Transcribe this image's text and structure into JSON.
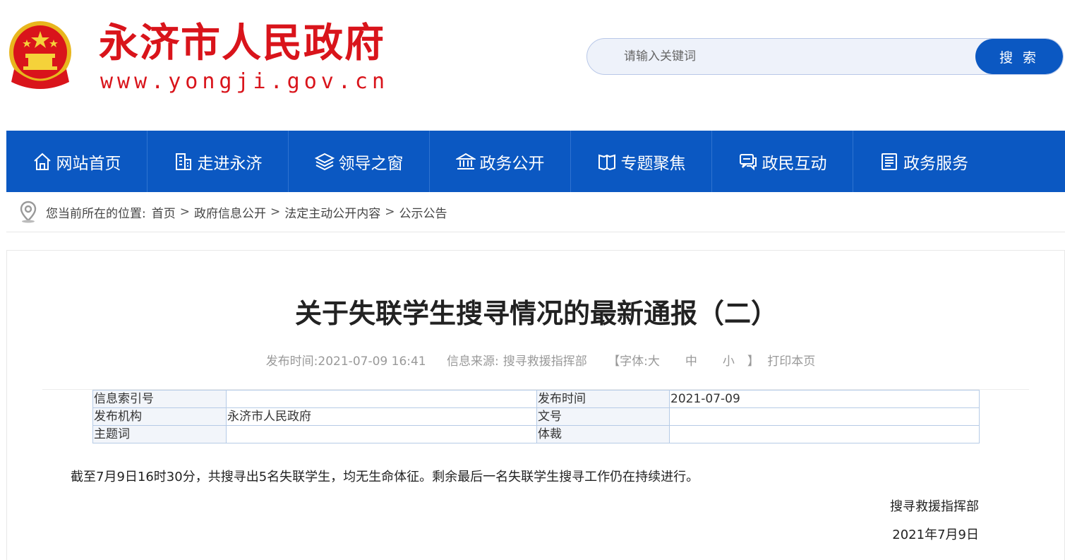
{
  "header": {
    "site_title": "永济市人民政府",
    "site_url": "www.yongji.gov.cn",
    "emblem_icon": "national-emblem-icon",
    "brand_color": "#d9141b"
  },
  "search": {
    "placeholder": "请输入关键词",
    "button_label": "搜 索",
    "button_color": "#0b58c2"
  },
  "nav": {
    "color": "#0b58c2",
    "items": [
      {
        "label": "网站首页",
        "icon": "home-icon"
      },
      {
        "label": "走进永济",
        "icon": "building-icon"
      },
      {
        "label": "领导之窗",
        "icon": "layers-icon"
      },
      {
        "label": "政务公开",
        "icon": "government-building-icon"
      },
      {
        "label": "专题聚焦",
        "icon": "book-icon"
      },
      {
        "label": "政民互动",
        "icon": "chat-icon"
      },
      {
        "label": "政务服务",
        "icon": "document-list-icon"
      }
    ]
  },
  "breadcrumb": {
    "prefix": "您当前所在的位置:",
    "items": [
      "首页",
      "政府信息公开",
      "法定主动公开内容",
      "公示公告"
    ],
    "separator": ">"
  },
  "article": {
    "title": "关于失联学生搜寻情况的最新通报（二）",
    "meta": {
      "publish_label": "发布时间:",
      "publish_time": "2021-07-09 16:41",
      "source_label": "信息来源:",
      "source": "搜寻救援指挥部",
      "font_label": "【字体:",
      "font_large": "大",
      "font_medium": "中",
      "font_small": "小",
      "font_close": "】",
      "print_label": "打印本页"
    },
    "info_table": {
      "rows": [
        {
          "label1": "信息索引号",
          "value1": "",
          "label2": "发布时间",
          "value2": "2021-07-09"
        },
        {
          "label1": "发布机构",
          "value1": "永济市人民政府",
          "label2": "文号",
          "value2": ""
        },
        {
          "label1": "主题词",
          "value1": "",
          "label2": "体裁",
          "value2": ""
        }
      ]
    },
    "body": "截至7月9日16时30分，共搜寻出5名失联学生，均无生命体征。剩余最后一名失联学生搜寻工作仍在持续进行。",
    "signature_org": "搜寻救援指挥部",
    "signature_date": "2021年7月9日"
  }
}
